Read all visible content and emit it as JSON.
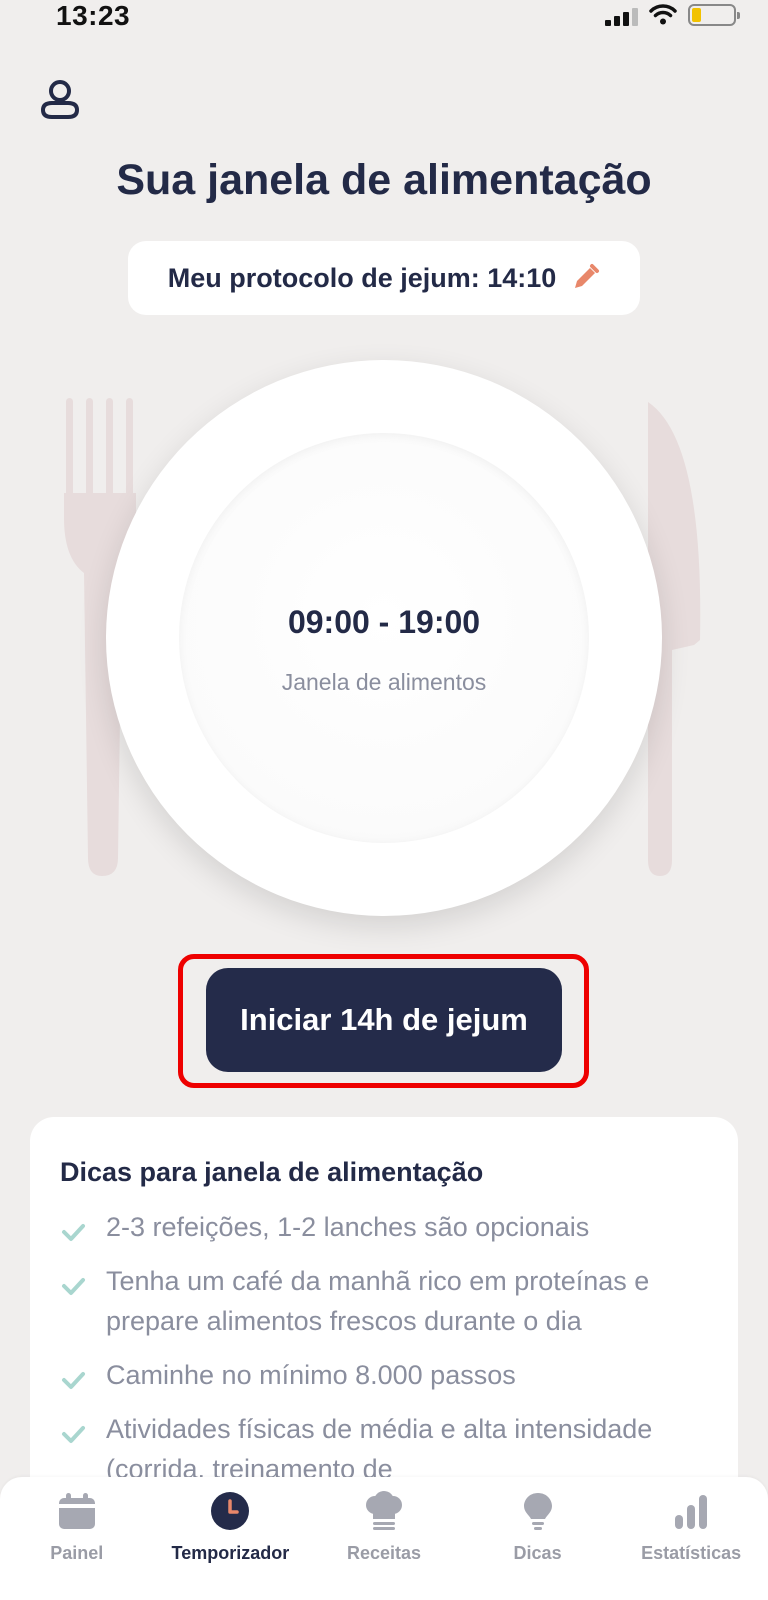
{
  "status_bar": {
    "time": "13:23"
  },
  "header": {
    "title": "Sua janela de alimentação"
  },
  "protocol": {
    "label": "Meu protocolo de jejum: 14:10"
  },
  "plate": {
    "time_range": "09:00 - 19:00",
    "caption": "Janela de alimentos"
  },
  "start_button": {
    "label": "Iniciar 14h de jejum"
  },
  "tips": {
    "title": "Dicas para janela de alimentação",
    "items": [
      "2-3 refeições, 1-2 lanches são opcionais",
      "Tenha um café da manhã rico em proteínas e prepare alimentos frescos durante o dia",
      "Caminhe no mínimo 8.000 passos",
      "Atividades físicas de média e alta intensidade (corrida, treinamento de"
    ]
  },
  "tab_bar": {
    "tabs": [
      {
        "label": "Painel",
        "icon": "calendar-icon"
      },
      {
        "label": "Temporizador",
        "icon": "clock-icon",
        "active": true
      },
      {
        "label": "Receitas",
        "icon": "chef-hat-icon"
      },
      {
        "label": "Dicas",
        "icon": "lightbulb-icon"
      },
      {
        "label": "Estatísticas",
        "icon": "bar-chart-icon"
      }
    ]
  },
  "colors": {
    "primary": "#242b4a",
    "accent": "#e8876a",
    "background": "#f0eeed",
    "check": "#a9d6cf",
    "highlight": "#ee0000"
  }
}
